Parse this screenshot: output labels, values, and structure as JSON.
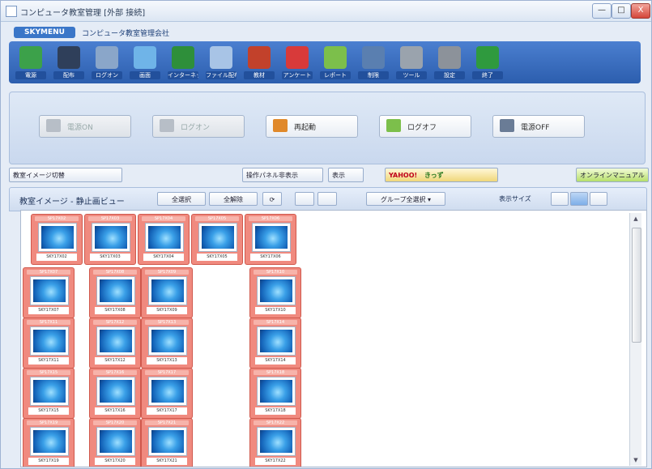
{
  "window": {
    "title": "コンピュータ教室管理 [外部 接続]",
    "min": "—",
    "max": "□",
    "close": "X"
  },
  "banner": {
    "logo": "SKYMENU",
    "brand": "コンピュータ教室管理会社"
  },
  "toolbar": {
    "items": [
      {
        "label": "電源",
        "color": "#3ca14a",
        "icon": "power-icon"
      },
      {
        "label": "配布",
        "color": "#2f3f5a",
        "icon": "book-icon"
      },
      {
        "label": "ログオン",
        "color": "#8aa6c9",
        "icon": "keyboard-icon"
      },
      {
        "label": "画面",
        "color": "#6fb4e8",
        "icon": "monitor-icon"
      },
      {
        "label": "インターネット",
        "color": "#2e8f3a",
        "icon": "globe-icon"
      },
      {
        "label": "ファイル配布",
        "color": "#a8c4e6",
        "icon": "file-icon"
      },
      {
        "label": "教材",
        "color": "#c2412b",
        "icon": "books-icon"
      },
      {
        "label": "アンケート",
        "color": "#d83a3a",
        "icon": "chart-icon"
      },
      {
        "label": "レポート",
        "color": "#7cbf4b",
        "icon": "check-icon"
      },
      {
        "label": "制限",
        "color": "#5a7fb0",
        "icon": "screen-lock-icon"
      },
      {
        "label": "ツール",
        "color": "#9aa3ad",
        "icon": "printer-icon"
      },
      {
        "label": "設定",
        "color": "#8c929a",
        "icon": "gear-icon"
      },
      {
        "label": "終了",
        "color": "#2f9a3e",
        "icon": "exit-icon"
      }
    ]
  },
  "panel": {
    "buttons": [
      {
        "label": "電源ON",
        "disabled": true,
        "color": "#b7bec7"
      },
      {
        "label": "ログオン",
        "disabled": true,
        "color": "#b7bec7"
      },
      {
        "label": "再起動",
        "disabled": false,
        "color": "#e0892a"
      },
      {
        "label": "ログオフ",
        "disabled": false,
        "color": "#7cbf4b"
      },
      {
        "label": "電源OFF",
        "disabled": false,
        "color": "#6a7c96"
      }
    ]
  },
  "strip": {
    "layout_toggle": "教室イメージ切替",
    "panel_btn": "操作パネル非表示",
    "window_btn": "表示",
    "yahoo": "YAHOO!",
    "kids": "きっず",
    "online_btn": "オンラインマニュアル"
  },
  "view": {
    "title": "教室イメージ - 静止画ビュー",
    "select_all": "全選択",
    "deselect_all": "全解除",
    "refresh": "⟳",
    "group_select": "グループ全選択",
    "size_label": "表示サイズ"
  },
  "pcs": [
    {
      "head": "SP17X02",
      "name": "SKY17X02"
    },
    {
      "head": "SP17X03",
      "name": "SKY17X03"
    },
    {
      "head": "SP17X04",
      "name": "SKY17X04"
    },
    {
      "head": "SP17X05",
      "name": "SKY17X05"
    },
    {
      "head": "SP17X06",
      "name": "SKY17X06"
    },
    {
      "head": "SP17X07",
      "name": "SKY17X07"
    },
    {
      "head": "SP17X08",
      "name": "SKY17X08"
    },
    {
      "head": "SP17X09",
      "name": "SKY17X09"
    },
    {
      "head": "SP17X10",
      "name": "SKY17X10"
    },
    {
      "head": "SP17X11",
      "name": "SKY17X11"
    },
    {
      "head": "SP17X12",
      "name": "SKY17X12"
    },
    {
      "head": "SP17X13",
      "name": "SKY17X13"
    },
    {
      "head": "SP17X14",
      "name": "SKY17X14"
    },
    {
      "head": "SP17X15",
      "name": "SKY17X15"
    },
    {
      "head": "SP17X16",
      "name": "SKY17X16"
    },
    {
      "head": "SP17X17",
      "name": "SKY17X17"
    },
    {
      "head": "SP17X18",
      "name": "SKY17X18"
    },
    {
      "head": "SP17X19",
      "name": "SKY17X19"
    },
    {
      "head": "SP17X20",
      "name": "SKY17X20"
    },
    {
      "head": "SP17X21",
      "name": "SKY17X21"
    },
    {
      "head": "SP17X22",
      "name": "SKY17X22"
    }
  ]
}
